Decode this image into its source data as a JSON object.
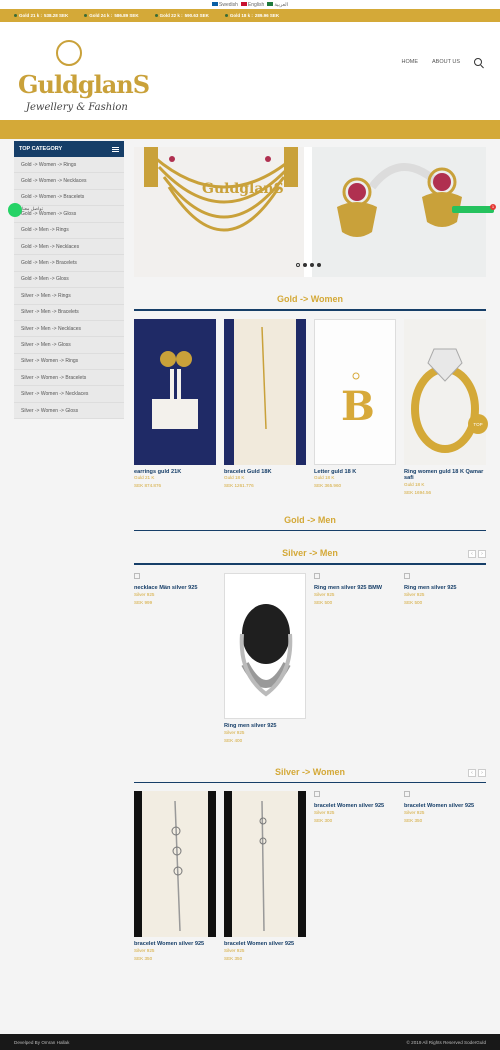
{
  "lang_bar": {
    "items": [
      "Swedish",
      "English",
      "العربية"
    ]
  },
  "ticker": {
    "items": [
      {
        "label": "Gold 21 k :",
        "value": "538.28 SEK"
      },
      {
        "label": "Gold 24 k :",
        "value": "586.89 SEK"
      },
      {
        "label": "Gold 22 k :",
        "value": "590.63 SEK"
      },
      {
        "label": "Gold 18 k :",
        "value": "289.96 SEK"
      }
    ]
  },
  "brand": {
    "name": "GuldglanS",
    "tagline": "Jewellery & Fashion"
  },
  "nav": {
    "home": "HOME",
    "about": "ABOUT US"
  },
  "sidebar": {
    "title": "TOP CATEGORY",
    "items": [
      "Gold -> Women -> Rings",
      "Gold -> Women -> Necklaces",
      "Gold -> Women -> Bracelets",
      "Gold -> Women -> Gloss",
      "Gold -> Men -> Rings",
      "Gold -> Men -> Necklaces",
      "Gold -> Men -> Bracelets",
      "Gold -> Men -> Gloss",
      "Silver -> Men -> Rings",
      "Silver -> Men -> Bracelets",
      "Silver -> Men -> Necklaces",
      "Silver -> Men -> Gloss",
      "Silver -> Women -> Rings",
      "Silver -> Women -> Bracelets",
      "Silver -> Women -> Necklaces",
      "Silver -> Women -> Gloss"
    ]
  },
  "whatsapp": {
    "label": "تواصل معنا"
  },
  "badge": {
    "count": "1"
  },
  "sections": {
    "gold_women": {
      "title": "Gold -> Women",
      "products": [
        {
          "title": "earrings guld 21K",
          "meta": "Guld 21 K",
          "price": "SEK 874.876"
        },
        {
          "title": "bracelet Guld 18K",
          "meta": "Guld 18 K",
          "price": "SEK 1261.776"
        },
        {
          "title": "Letter guld 18 K",
          "meta": "Guld 18 K",
          "price": "SEK 365.960"
        },
        {
          "title": "Ring women guld 18 K Qamar safi",
          "meta": "Guld 18 K",
          "price": "SEK 1694.56"
        }
      ]
    },
    "gold_men": {
      "title": "Gold -> Men"
    },
    "silver_men": {
      "title": "Silver -> Men",
      "products": [
        {
          "title": "necklace Män silver 925",
          "meta": "Silver 925",
          "price": "SEK 999"
        },
        {
          "title": "Ring men silver 925",
          "meta": "Silver 925",
          "price": "SEK 400"
        },
        {
          "title": "Ring men silver 925 BMW",
          "meta": "Silver 925",
          "price": "SEK 500"
        },
        {
          "title": "Ring men silver 925",
          "meta": "Silver 925",
          "price": "SEK 500"
        }
      ]
    },
    "silver_women": {
      "title": "Silver -> Women",
      "products": [
        {
          "title": "bracelet Women silver 925",
          "meta": "Silver 925",
          "price": "SEK 350"
        },
        {
          "title": "bracelet Women silver 925",
          "meta": "Silver 925",
          "price": "SEK 350"
        },
        {
          "title": "bracelet Women silver 925",
          "meta": "Silver 925",
          "price": "SEK 300"
        },
        {
          "title": "bracelet Women silver 925",
          "meta": "Silver 925",
          "price": "SEK 350"
        }
      ]
    }
  },
  "top_button": "TOP",
  "footer": {
    "left": "Develped By Omran Hallak",
    "right": "© 2019 All Rights Reserved SoderGuld"
  },
  "colors": {
    "gold": "#d4a938",
    "navy": "#163e68",
    "footer": "#181818"
  }
}
